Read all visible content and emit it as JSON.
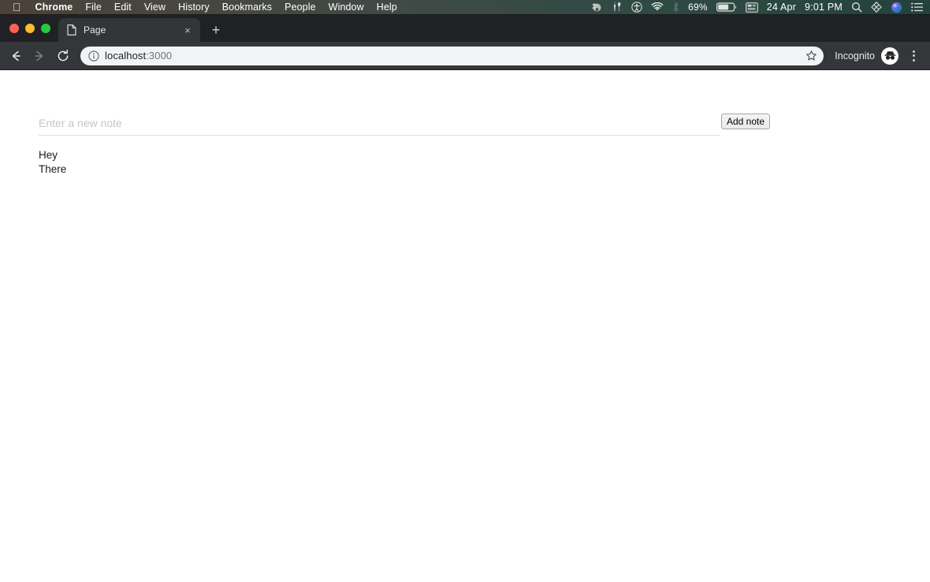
{
  "menubar": {
    "apple_icon": "apple-logo",
    "items": [
      {
        "label": "Chrome",
        "bold": true
      },
      {
        "label": "File",
        "bold": false
      },
      {
        "label": "Edit",
        "bold": false
      },
      {
        "label": "View",
        "bold": false
      },
      {
        "label": "History",
        "bold": false
      },
      {
        "label": "Bookmarks",
        "bold": false
      },
      {
        "label": "People",
        "bold": false
      },
      {
        "label": "Window",
        "bold": false
      },
      {
        "label": "Help",
        "bold": false
      }
    ],
    "status_icons": [
      "dropbox-icon",
      "tools-icon",
      "accessibility-icon",
      "wifi-icon",
      "bluetooth-icon"
    ],
    "battery_percent": "69%",
    "screen_icon": "display-icon",
    "date": "24 Apr",
    "time": "9:01 PM",
    "right_icons": [
      "spotlight-search-icon",
      "app-icon",
      "siri-icon",
      "control-center-icon"
    ],
    "colors": {
      "gradient_left": "#4a4239",
      "gradient_right": "#24423c",
      "text": "#ffffff"
    }
  },
  "browser": {
    "window_controls": {
      "close": "#ff5f57",
      "minimize": "#ffbd2e",
      "maximize": "#28c840"
    },
    "tabs": [
      {
        "title": "Page",
        "favicon": "document-icon",
        "active": true
      }
    ],
    "new_tab_label": "+",
    "tab_close_label": "×",
    "toolbar": {
      "back_label": "Back",
      "forward_label": "Forward",
      "reload_label": "Reload",
      "url": "localhost",
      "url_port": ":3000",
      "security_icon": "info-circle-icon",
      "bookmark_icon": "star-icon",
      "incognito_label": "Incognito",
      "incognito_icon": "incognito-icon",
      "menu_icon": "kebab-menu-icon"
    },
    "colors": {
      "tabstrip_bg": "#202124",
      "active_tab_bg": "#323639",
      "toolbar_bg": "#35363a",
      "omnibox_bg": "#f1f3f4"
    }
  },
  "page": {
    "input": {
      "placeholder": "Enter a new note",
      "value": ""
    },
    "add_button_label": "Add note",
    "notes": [
      {
        "text": "Hey"
      },
      {
        "text": "There"
      }
    ]
  }
}
